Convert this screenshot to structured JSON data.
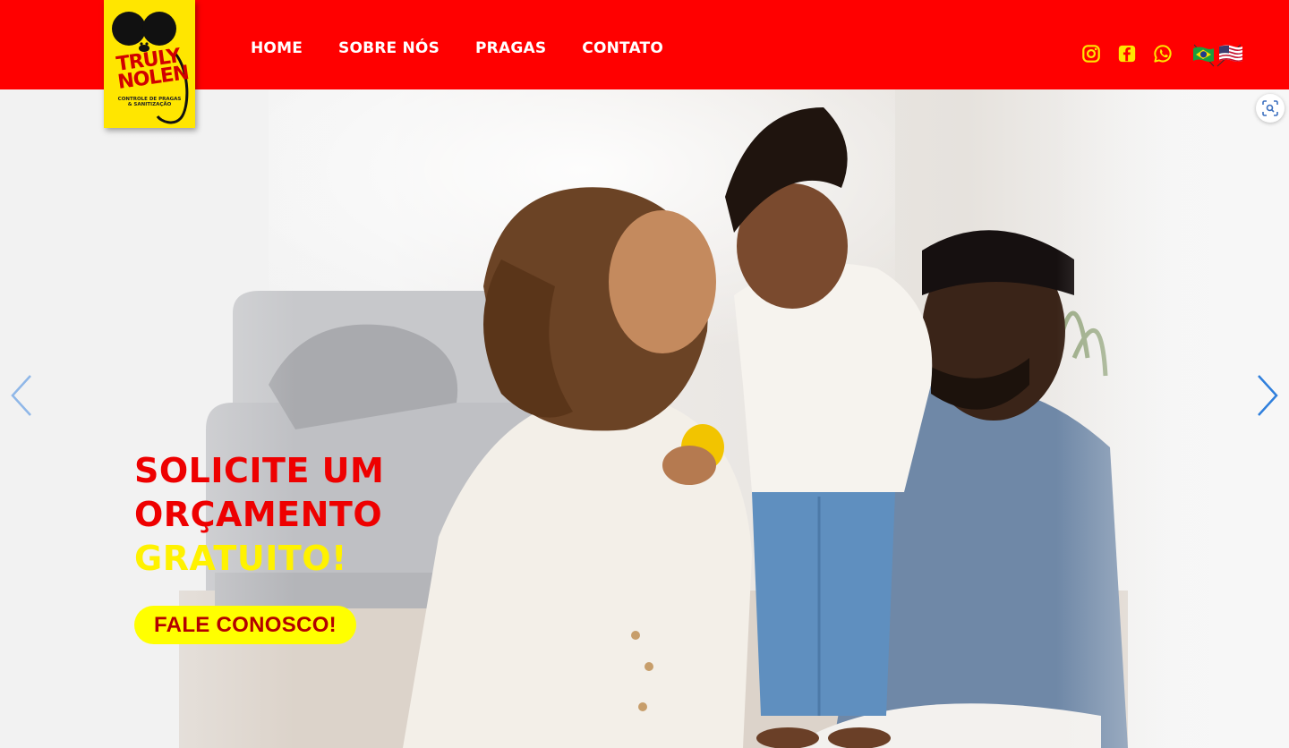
{
  "brand": {
    "logo_text_line1": "TRULY",
    "logo_text_line2": "NOLEN",
    "logo_subtitle": "CONTROLE DE PRAGAS & SANITIZAÇÃO",
    "logo_bg": "#ffe600",
    "header_bg": "#ff0000"
  },
  "nav": {
    "items": [
      {
        "label": "HOME"
      },
      {
        "label": "SOBRE NÓS"
      },
      {
        "label": "PRAGAS"
      },
      {
        "label": "CONTATO"
      }
    ]
  },
  "socials": {
    "icons": [
      "instagram-icon",
      "facebook-icon",
      "whatsapp-icon"
    ],
    "icon_color": "#ffe600",
    "languages": [
      "brazil-flag-icon",
      "usa-flag-icon"
    ]
  },
  "hero": {
    "title_line1": "SOLICITE UM",
    "title_line2": "ORÇAMENTO",
    "title_accent": "GRATUITO!",
    "title_color": "#ee0000",
    "accent_color": "#fff200",
    "cta_label": "FALE CONOSCO!",
    "cta_bg": "#ffff00",
    "cta_text_color": "#b30000",
    "arrow_color": "#4a90e2"
  }
}
